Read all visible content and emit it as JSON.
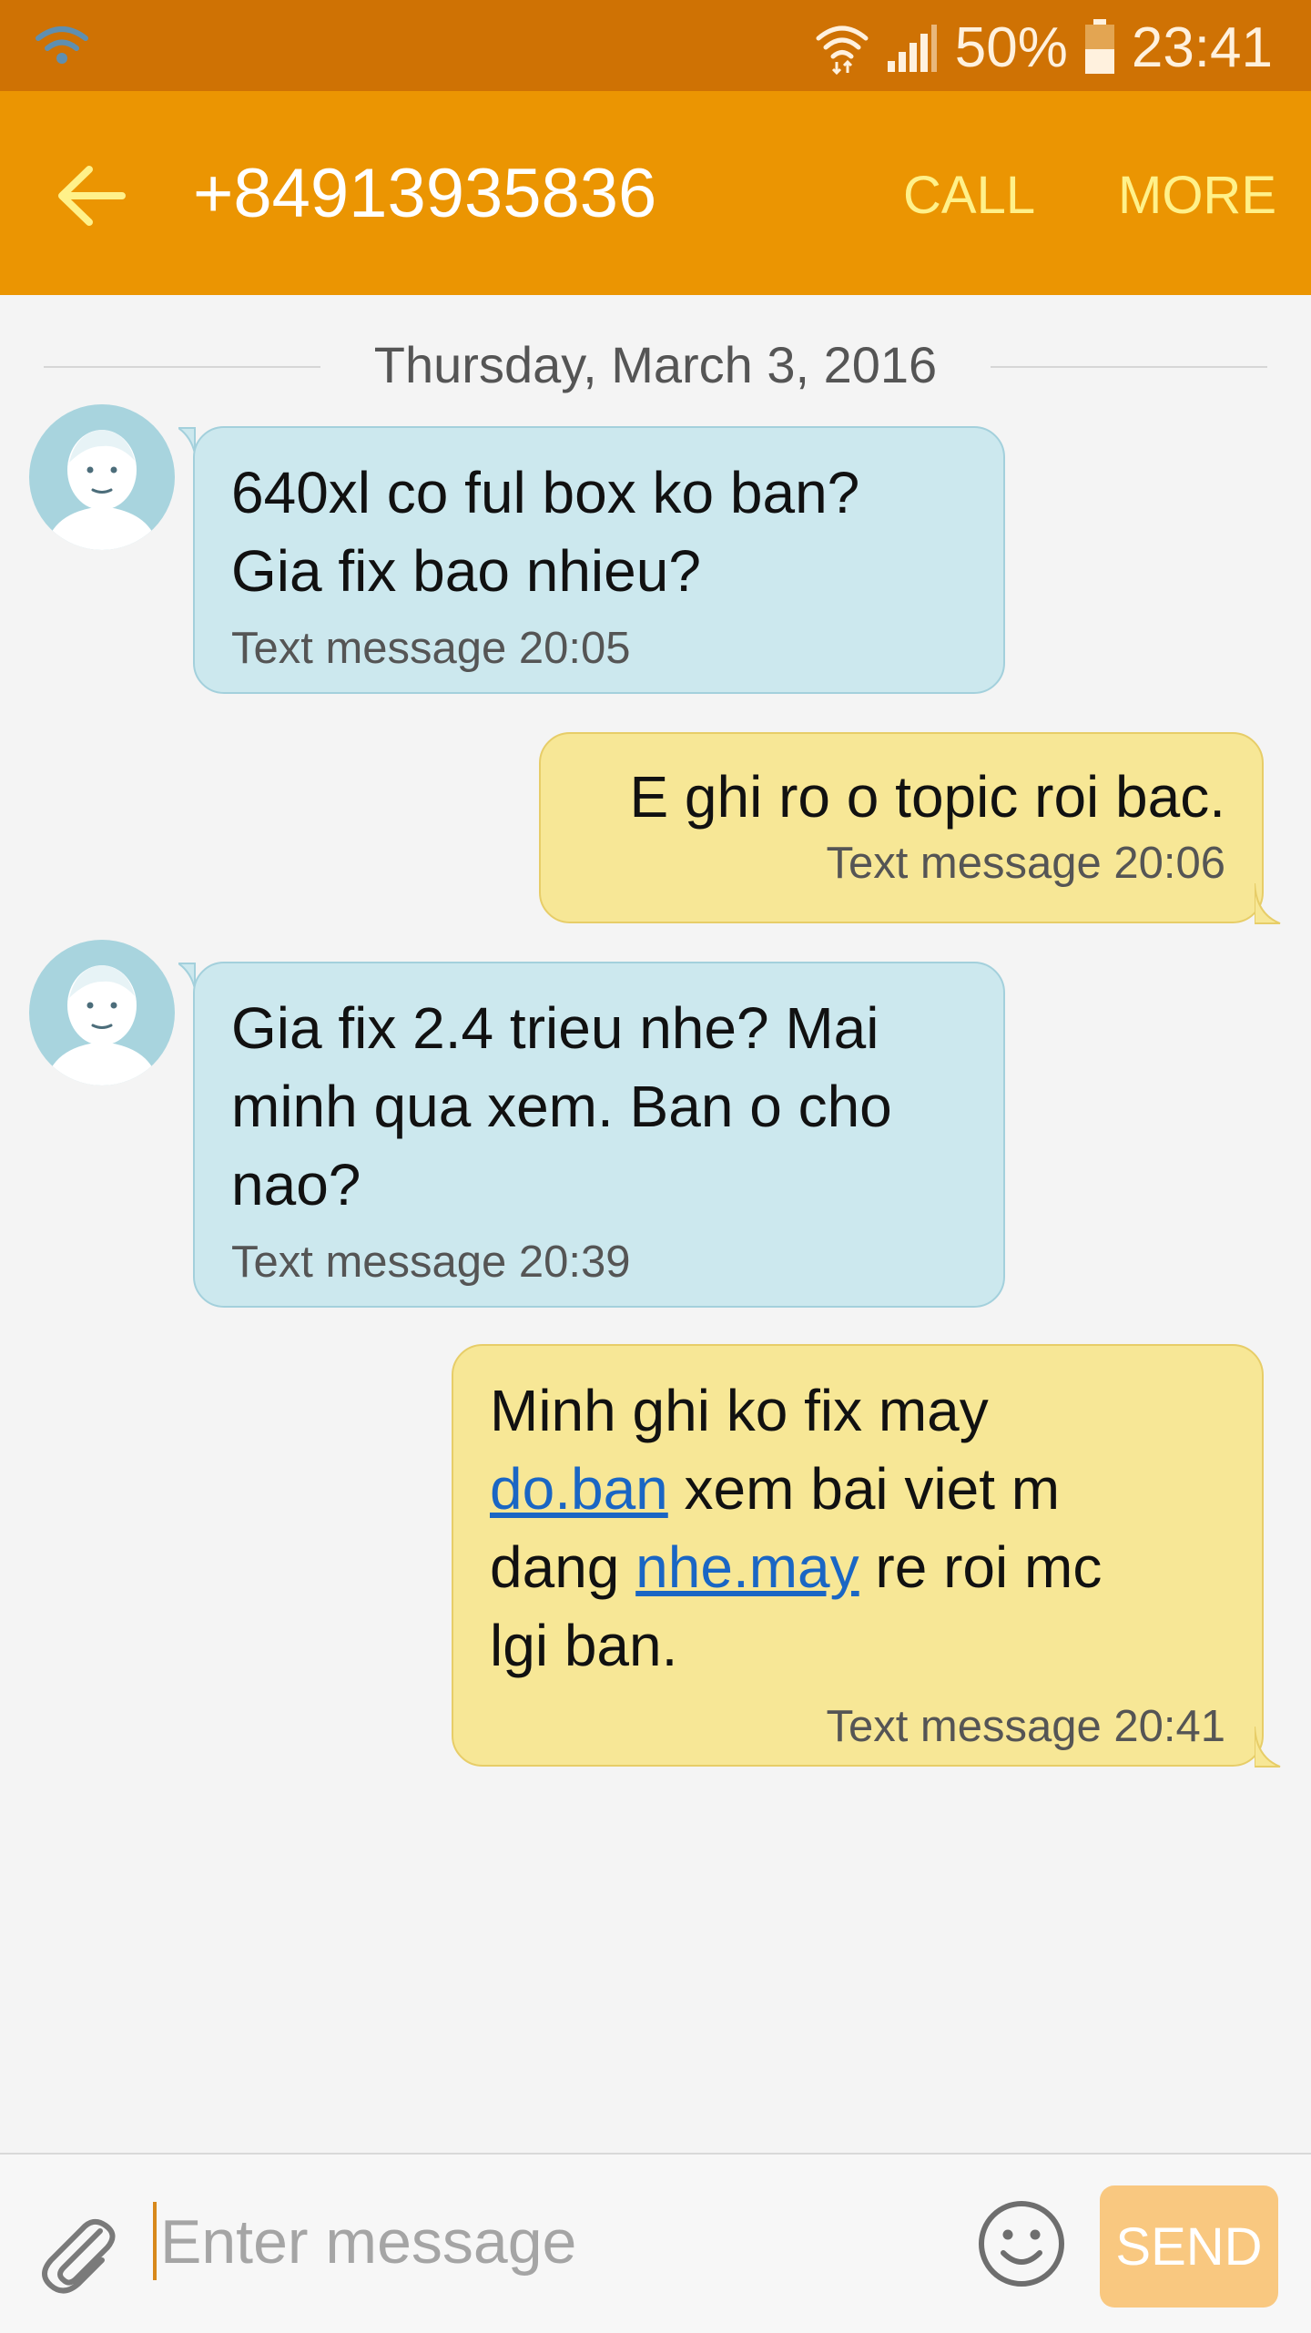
{
  "status_bar": {
    "battery_percent": "50%",
    "battery_level": 0.5,
    "time": "23:41"
  },
  "header": {
    "title": "+84913935836",
    "call_label": "CALL",
    "more_label": "MORE"
  },
  "date_divider": "Thursday, March 3, 2016",
  "messages": [
    {
      "direction": "incoming",
      "lines": [
        "640xl co ful box ko ban?",
        "Gia fix bao nhieu?"
      ],
      "meta": "Text message 20:05"
    },
    {
      "direction": "outgoing",
      "lines": [
        "E ghi ro o topic roi bac."
      ],
      "meta": "Text message 20:06"
    },
    {
      "direction": "incoming",
      "lines": [
        "Gia fix 2.4 trieu nhe? Mai",
        "minh qua xem. Ban o cho",
        "nao?"
      ],
      "meta": "Text message 20:39"
    },
    {
      "direction": "outgoing",
      "line1": "Minh ghi ko fix may",
      "link1": "do.ban",
      "line2_rest": " xem bai viet m",
      "line3_pre": "dang ",
      "link2": "nhe.may",
      "line3_rest": " re roi mc",
      "line4": "lgi ban.",
      "meta": "Text message 20:41"
    }
  ],
  "composer": {
    "placeholder": "Enter message",
    "send_label": "SEND"
  }
}
